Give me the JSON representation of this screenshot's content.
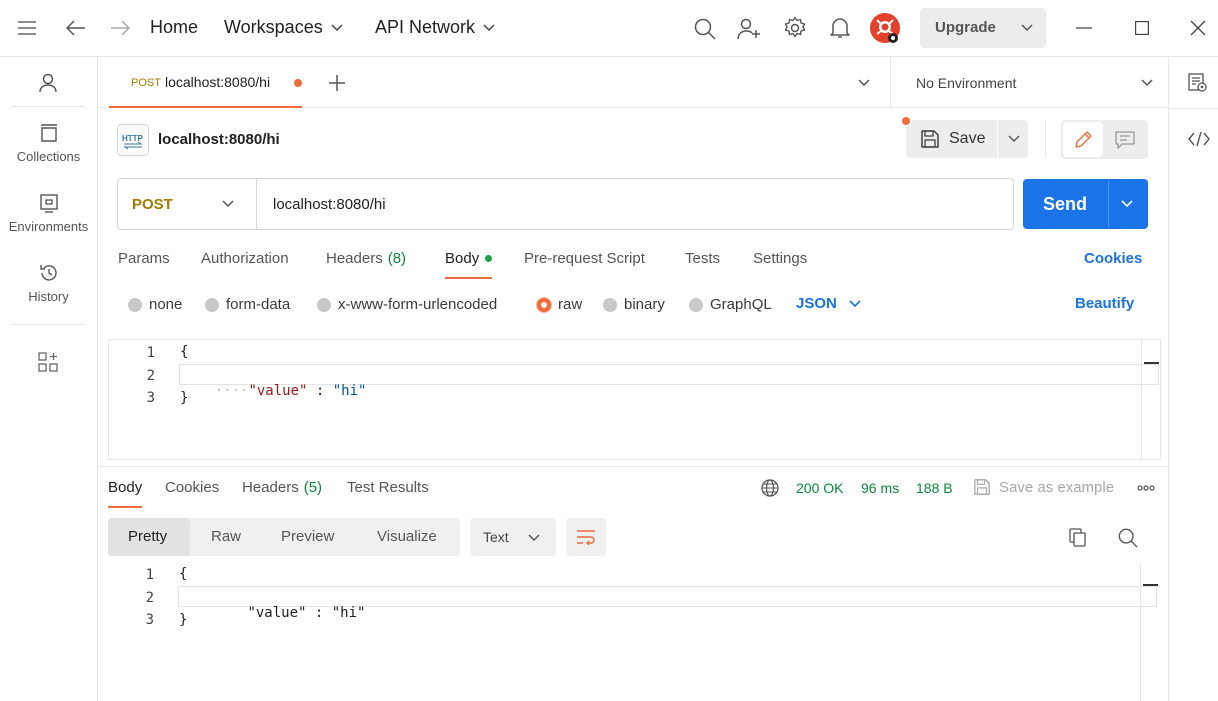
{
  "titlebar": {
    "home": "Home",
    "workspaces": "Workspaces",
    "api_network": "API Network",
    "upgrade": "Upgrade"
  },
  "sidebar": {
    "items": [
      {
        "label": "Collections",
        "icon": "collections-icon"
      },
      {
        "label": "Environments",
        "icon": "environments-icon"
      },
      {
        "label": "History",
        "icon": "history-icon"
      }
    ]
  },
  "tab": {
    "method": "POST",
    "title": "localhost:8080/hi",
    "unsaved_color": "#f26b3a"
  },
  "environment": {
    "selected": "No Environment"
  },
  "request": {
    "name": "localhost:8080/hi",
    "save_label": "Save",
    "method": "POST",
    "url": "localhost:8080/hi",
    "send_label": "Send"
  },
  "request_tabs": {
    "params": "Params",
    "authorization": "Authorization",
    "headers": "Headers",
    "headers_count": "(8)",
    "body": "Body",
    "prerequest": "Pre-request Script",
    "tests": "Tests",
    "settings": "Settings",
    "cookies": "Cookies"
  },
  "body_types": {
    "none": "none",
    "form_data": "form-data",
    "urlencoded": "x-www-form-urlencoded",
    "raw": "raw",
    "binary": "binary",
    "graphql": "GraphQL",
    "format": "JSON",
    "beautify": "Beautify"
  },
  "request_body": {
    "line_numbers": [
      "1",
      "2",
      "3"
    ],
    "open_brace": "{",
    "indent": "····",
    "key": "\"value\"",
    "colon": " : ",
    "value": "\"hi\"",
    "close_brace": "}"
  },
  "response_tabs": {
    "body": "Body",
    "cookies": "Cookies",
    "headers": "Headers",
    "headers_count": "(5)",
    "test_results": "Test Results"
  },
  "response_status": {
    "status": "200 OK",
    "time": "96 ms",
    "size": "188 B",
    "save_example": "Save as example",
    "status_color": "#0a8a3a"
  },
  "response_view": {
    "pretty": "Pretty",
    "raw": "Raw",
    "preview": "Preview",
    "visualize": "Visualize",
    "format": "Text"
  },
  "response_body": {
    "line_numbers": [
      "1",
      "2",
      "3"
    ],
    "open_brace": "{",
    "indent": "    ",
    "key": "\"value\"",
    "colon": " : ",
    "value": "\"hi\"",
    "close_brace": "}"
  },
  "colors": {
    "accent": "#f26b3a",
    "send": "#1a73e8",
    "link": "#1a73e8",
    "method": "#a67a00"
  }
}
